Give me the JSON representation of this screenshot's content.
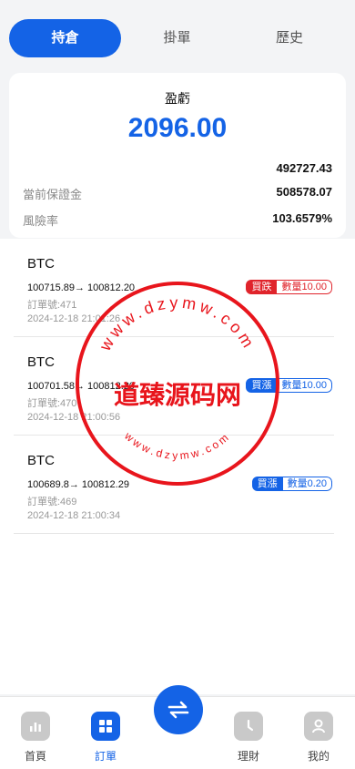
{
  "tabs": [
    "持倉",
    "掛單",
    "歷史"
  ],
  "summary": {
    "pnl_label": "盈虧",
    "pnl_value": "2096.00",
    "balance": "492727.43",
    "margin_label": "當前保證金",
    "margin_value": "508578.07",
    "risk_label": "風險率",
    "risk_value": "103.6579%"
  },
  "orders": [
    {
      "symbol": "BTC",
      "price": "100715.89→ 100812.20",
      "order_no": "訂單號:471",
      "time": "2024-12-18 21:01:26",
      "side": "買跌",
      "qty": "數量10.00"
    },
    {
      "symbol": "BTC",
      "price": "100701.58→ 100812.20",
      "order_no": "訂單號:470",
      "time": "2024-12-18 21:00:56",
      "side": "買漲",
      "qty": "數量10.00"
    },
    {
      "symbol": "BTC",
      "price": "100689.8→ 100812.29",
      "order_no": "訂單號:469",
      "time": "2024-12-18 21:00:34",
      "side": "買漲",
      "qty": "數量0.20"
    }
  ],
  "nav": [
    "首頁",
    "訂單",
    "理財",
    "我的"
  ],
  "watermark": {
    "top_text": "www.dzymw.com",
    "center_text": "道臻源码网",
    "bottom_text": "www.dzymw.com"
  },
  "colors": {
    "accent": "#1463e6",
    "down": "#e0242b",
    "watermark": "#e8151c"
  }
}
